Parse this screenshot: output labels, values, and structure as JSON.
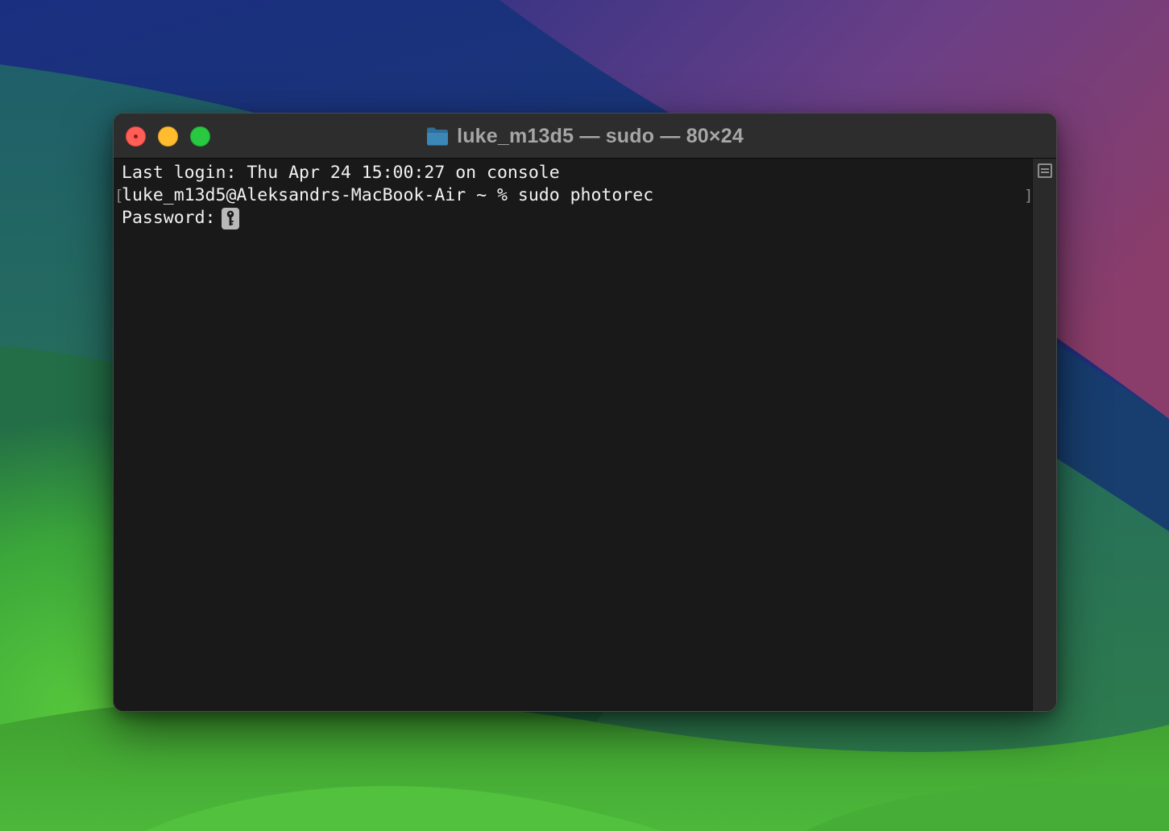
{
  "window": {
    "title": "luke_m13d5 — sudo — 80×24",
    "title_icon": "folder-icon"
  },
  "traffic_lights": {
    "close_color": "#ff5f57",
    "minimize_color": "#febc2e",
    "zoom_color": "#28c840"
  },
  "terminal": {
    "lines": [
      "Last login: Thu Apr 24 15:00:27 on console",
      "luke_m13d5@Aleksandrs-MacBook-Air ~ % sudo photorec",
      "Password:"
    ],
    "mark_open": "[",
    "mark_close": "]",
    "cursor_icon": "key-icon",
    "background": "#191919",
    "foreground": "#f2f2f2"
  },
  "scrollbar": {
    "marks_icon": "marks-list-icon"
  }
}
